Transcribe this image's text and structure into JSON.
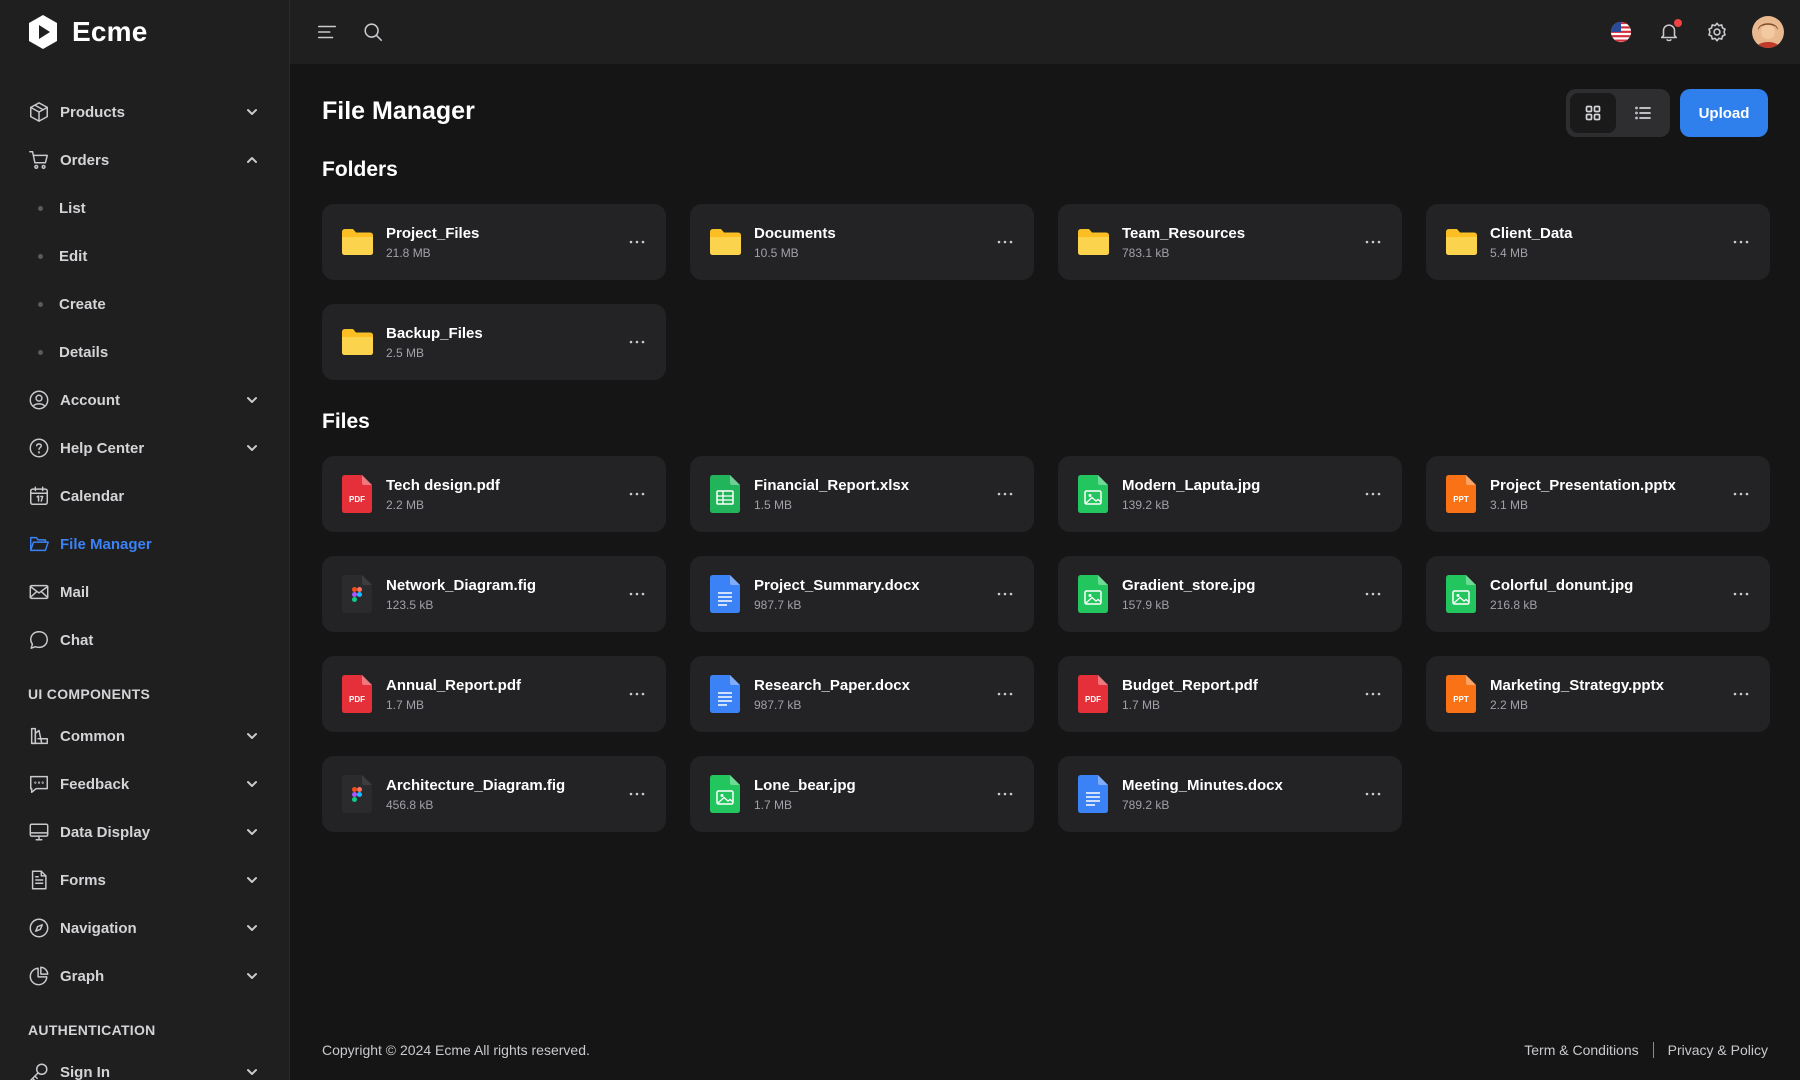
{
  "brand": {
    "name": "Ecme"
  },
  "sidebar": {
    "items": [
      {
        "label": "Products",
        "icon": "box-icon"
      },
      {
        "label": "Orders",
        "icon": "cart-icon"
      },
      {
        "label": "List"
      },
      {
        "label": "Edit"
      },
      {
        "label": "Create"
      },
      {
        "label": "Details"
      },
      {
        "label": "Account",
        "icon": "user-circle-icon"
      },
      {
        "label": "Help Center",
        "icon": "help-circle-icon"
      },
      {
        "label": "Calendar",
        "icon": "calendar-icon"
      },
      {
        "label": "File Manager",
        "icon": "folder-icon"
      },
      {
        "label": "Mail",
        "icon": "mail-icon"
      },
      {
        "label": "Chat",
        "icon": "chat-icon"
      }
    ],
    "section_ui": "UI COMPONENTS",
    "ui_items": [
      {
        "label": "Common",
        "icon": "shapes-icon"
      },
      {
        "label": "Feedback",
        "icon": "message-square-icon"
      },
      {
        "label": "Data Display",
        "icon": "monitor-icon"
      },
      {
        "label": "Forms",
        "icon": "file-text-icon"
      },
      {
        "label": "Navigation",
        "icon": "compass-icon"
      },
      {
        "label": "Graph",
        "icon": "pie-chart-icon"
      }
    ],
    "section_auth": "AUTHENTICATION",
    "auth_items": [
      {
        "label": "Sign In",
        "icon": "key-icon"
      }
    ]
  },
  "topbar": {
    "icons": [
      "menu-icon",
      "search-icon",
      "us-flag-icon",
      "bell-icon",
      "gear-icon",
      "avatar"
    ]
  },
  "main": {
    "title": "File Manager",
    "upload_label": "Upload",
    "folders_title": "Folders",
    "files_title": "Files",
    "folders": [
      {
        "name": "Project_Files",
        "size": "21.8 MB"
      },
      {
        "name": "Documents",
        "size": "10.5 MB"
      },
      {
        "name": "Team_Resources",
        "size": "783.1 kB"
      },
      {
        "name": "Client_Data",
        "size": "5.4 MB"
      },
      {
        "name": "Backup_Files",
        "size": "2.5 MB"
      }
    ],
    "files": [
      {
        "name": "Tech design.pdf",
        "size": "2.2 MB",
        "type": "pdf"
      },
      {
        "name": "Financial_Report.xlsx",
        "size": "1.5 MB",
        "type": "xlsx"
      },
      {
        "name": "Modern_Laputa.jpg",
        "size": "139.2 kB",
        "type": "jpg"
      },
      {
        "name": "Project_Presentation.pptx",
        "size": "3.1 MB",
        "type": "pptx"
      },
      {
        "name": "Network_Diagram.fig",
        "size": "123.5 kB",
        "type": "fig"
      },
      {
        "name": "Project_Summary.docx",
        "size": "987.7 kB",
        "type": "docx"
      },
      {
        "name": "Gradient_store.jpg",
        "size": "157.9 kB",
        "type": "jpg"
      },
      {
        "name": "Colorful_donunt.jpg",
        "size": "216.8 kB",
        "type": "jpg"
      },
      {
        "name": "Annual_Report.pdf",
        "size": "1.7 MB",
        "type": "pdf"
      },
      {
        "name": "Research_Paper.docx",
        "size": "987.7 kB",
        "type": "docx"
      },
      {
        "name": "Budget_Report.pdf",
        "size": "1.7 MB",
        "type": "pdf"
      },
      {
        "name": "Marketing_Strategy.pptx",
        "size": "2.2 MB",
        "type": "pptx"
      },
      {
        "name": "Architecture_Diagram.fig",
        "size": "456.8 kB",
        "type": "fig"
      },
      {
        "name": "Lone_bear.jpg",
        "size": "1.7 MB",
        "type": "jpg"
      },
      {
        "name": "Meeting_Minutes.docx",
        "size": "789.2 kB",
        "type": "docx"
      }
    ],
    "file_badges": {
      "pdf": "PDF",
      "pptx": "PPT"
    }
  },
  "footer": {
    "copyright": "Copyright © 2024 Ecme All rights reserved.",
    "terms": "Term & Conditions",
    "privacy": "Privacy & Policy"
  },
  "colors": {
    "accent": "#2f80ed",
    "folder": "#fbbf24",
    "pdf": "#e5303a",
    "xlsx": "#22b45a",
    "jpg": "#22c55e",
    "pptx": "#f97316",
    "docx": "#3b82f6"
  }
}
